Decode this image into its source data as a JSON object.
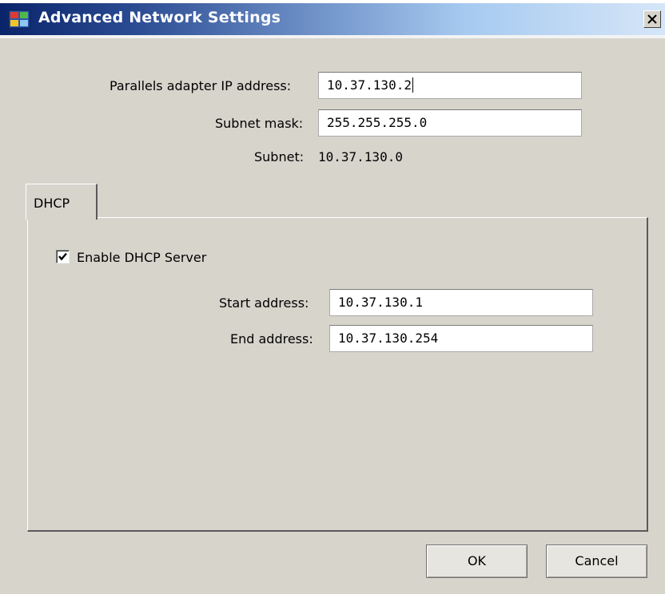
{
  "window": {
    "title": "Advanced Network Settings",
    "close_label": "close"
  },
  "adapter": {
    "ip_label": "Parallels adapter IP address:",
    "ip_value": "10.37.130.2",
    "mask_label": "Subnet mask:",
    "mask_value": "255.255.255.0",
    "subnet_label": "Subnet:",
    "subnet_value": "10.37.130.0"
  },
  "tabs": [
    {
      "label": "DHCP",
      "active": true
    }
  ],
  "dhcp": {
    "enable_label": "Enable DHCP Server",
    "enabled": true,
    "start_label": "Start address:",
    "start_value": "10.37.130.1",
    "end_label": "End address:",
    "end_value": "10.37.130.254"
  },
  "buttons": {
    "ok": "OK",
    "cancel": "Cancel"
  },
  "colors": {
    "dialog_bg": "#d7d4cc",
    "title_start": "#0a246a",
    "title_end": "#d6e6f8"
  },
  "icons": {
    "app": "network-settings-icon",
    "close": "close-icon",
    "check": "checkmark-icon"
  }
}
